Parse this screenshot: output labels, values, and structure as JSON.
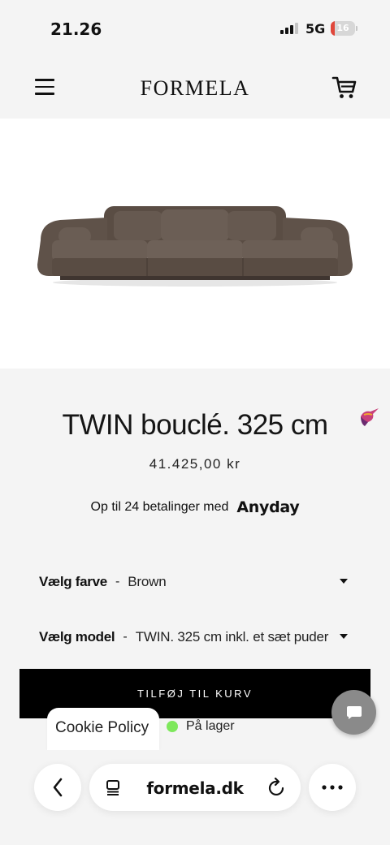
{
  "status_bar": {
    "time": "21.26",
    "network": "5G",
    "battery_level": "16"
  },
  "header": {
    "logo": "FORMELA",
    "menu_icon": "hamburger-menu-icon",
    "cart_icon": "shopping-cart-icon"
  },
  "hero": {
    "image": "brown boucle sofa",
    "badge_icon": "hummingbird-icon"
  },
  "product": {
    "title": "TWIN bouclé. 325 cm",
    "price": "41.425,00 kr",
    "payment_text": "Op til 24 betalinger med",
    "payment_brand": "Anyday"
  },
  "options": {
    "color": {
      "label": "Vælg farve",
      "separator": "-",
      "value": "Brown"
    },
    "model": {
      "label": "Vælg model",
      "separator": "-",
      "value": "TWIN. 325 cm inkl. et sæt puder"
    }
  },
  "actions": {
    "add_to_cart": "TILFØJ TIL KURV",
    "chat_icon": "chat-bubble-icon"
  },
  "cookie": {
    "label": "Cookie Policy"
  },
  "stock": {
    "label": "På lager",
    "color": "#7ee85c"
  },
  "browser": {
    "url": "formela.dk",
    "back_icon": "chevron-left-icon",
    "tabs_icon": "reader-icon",
    "reload_icon": "reload-icon",
    "more_icon": "more-dots-icon"
  }
}
